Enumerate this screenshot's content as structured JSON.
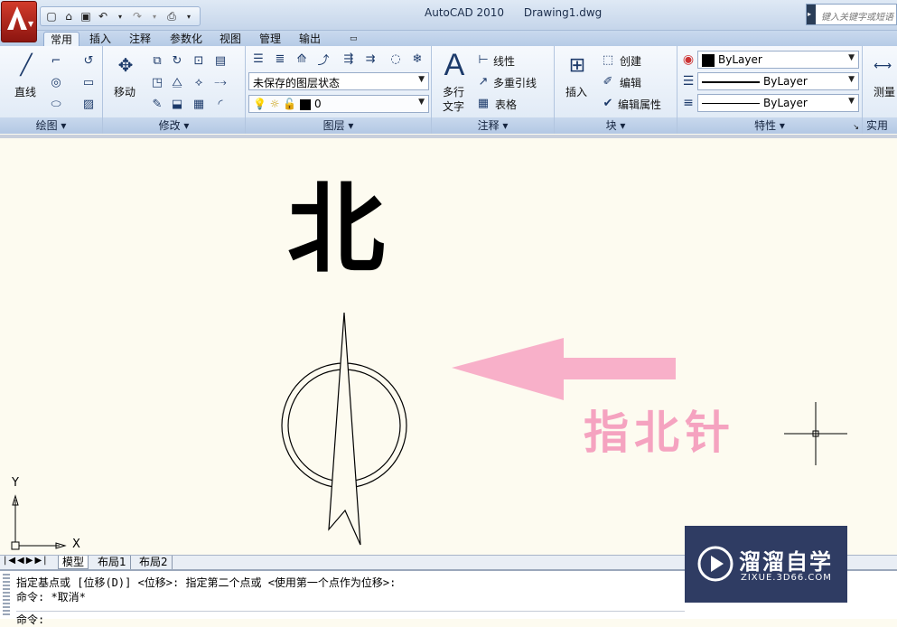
{
  "window": {
    "app_title": "AutoCAD 2010",
    "file_name": "Drawing1.dwg"
  },
  "help_search": {
    "placeholder": "键入关键字或短语"
  },
  "ribbon_tabs": [
    "常用",
    "插入",
    "注释",
    "参数化",
    "视图",
    "管理",
    "输出"
  ],
  "panels": {
    "draw": {
      "title": "绘图",
      "line_label": "直线"
    },
    "modify": {
      "title": "修改",
      "move_label": "移动"
    },
    "layers": {
      "title": "图层",
      "layer_state": "未保存的图层状态",
      "current_layer": "0"
    },
    "annotation": {
      "title": "注释",
      "multiline_text_label_1": "多行",
      "multiline_text_label_2": "文字",
      "linear_label": "线性",
      "multileader_label": "多重引线",
      "table_label": "表格"
    },
    "block": {
      "title": "块",
      "insert_label": "插入",
      "create_label": "创建",
      "edit_label": "编辑",
      "edit_attributes_label": "编辑属性"
    },
    "properties": {
      "title": "特性",
      "color": "ByLayer",
      "linetype": "ByLayer",
      "lineweight": "ByLayer"
    },
    "utilities": {
      "title": "实用工",
      "measure_label": "测量"
    }
  },
  "drawing": {
    "north_char": "北",
    "annotation_text": "指北针",
    "annotation_color": "#f5a3c0",
    "axis_x_label": "X",
    "axis_y_label": "Y"
  },
  "layout_tabs": {
    "model": "模型",
    "layout1": "布局1",
    "layout2": "布局2"
  },
  "command_line": {
    "line1": "指定基点或 [位移(D)] <位移>:  指定第二个点或 <使用第一个点作为位移>:",
    "line2": "命令: *取消*",
    "line3": "命令:"
  },
  "watermark": {
    "name": "溜溜自学",
    "url": "ZIXUE.3D66.COM"
  }
}
